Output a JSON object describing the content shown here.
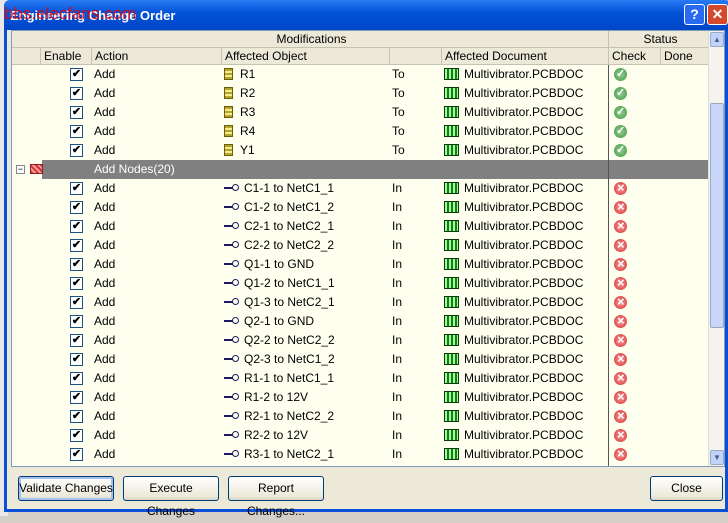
{
  "window": {
    "title": "Engineering Change Order",
    "watermark": "bbs.elecfans.com",
    "help": "?",
    "close": "✕"
  },
  "headers": {
    "group_modifications": "Modifications",
    "group_status": "Status",
    "enable": "Enable",
    "action": "Action",
    "affected_object": "Affected Object",
    "affected_document": "Affected Document",
    "check": "Check",
    "done": "Done"
  },
  "rows": [
    {
      "type": "item",
      "enabled": true,
      "action": "Add",
      "icon": "component-icon",
      "object": "R1",
      "dir": "To",
      "document": "Multivibrator.PCBDOC",
      "check": "ok"
    },
    {
      "type": "item",
      "enabled": true,
      "action": "Add",
      "icon": "component-icon",
      "object": "R2",
      "dir": "To",
      "document": "Multivibrator.PCBDOC",
      "check": "ok"
    },
    {
      "type": "item",
      "enabled": true,
      "action": "Add",
      "icon": "component-icon",
      "object": "R3",
      "dir": "To",
      "document": "Multivibrator.PCBDOC",
      "check": "ok"
    },
    {
      "type": "item",
      "enabled": true,
      "action": "Add",
      "icon": "component-icon",
      "object": "R4",
      "dir": "To",
      "document": "Multivibrator.PCBDOC",
      "check": "ok"
    },
    {
      "type": "item",
      "enabled": true,
      "action": "Add",
      "icon": "component-icon",
      "object": "Y1",
      "dir": "To",
      "document": "Multivibrator.PCBDOC",
      "check": "ok"
    },
    {
      "type": "group",
      "label": "Add Nodes(20)",
      "expanded": true
    },
    {
      "type": "item",
      "enabled": true,
      "action": "Add",
      "icon": "pin-icon",
      "object": "C1-1 to NetC1_1",
      "dir": "In",
      "document": "Multivibrator.PCBDOC",
      "check": "error"
    },
    {
      "type": "item",
      "enabled": true,
      "action": "Add",
      "icon": "pin-icon",
      "object": "C1-2 to NetC1_2",
      "dir": "In",
      "document": "Multivibrator.PCBDOC",
      "check": "error"
    },
    {
      "type": "item",
      "enabled": true,
      "action": "Add",
      "icon": "pin-icon",
      "object": "C2-1 to NetC2_1",
      "dir": "In",
      "document": "Multivibrator.PCBDOC",
      "check": "error"
    },
    {
      "type": "item",
      "enabled": true,
      "action": "Add",
      "icon": "pin-icon",
      "object": "C2-2 to NetC2_2",
      "dir": "In",
      "document": "Multivibrator.PCBDOC",
      "check": "error"
    },
    {
      "type": "item",
      "enabled": true,
      "action": "Add",
      "icon": "pin-icon",
      "object": "Q1-1 to GND",
      "dir": "In",
      "document": "Multivibrator.PCBDOC",
      "check": "error"
    },
    {
      "type": "item",
      "enabled": true,
      "action": "Add",
      "icon": "pin-icon",
      "object": "Q1-2 to NetC1_1",
      "dir": "In",
      "document": "Multivibrator.PCBDOC",
      "check": "error"
    },
    {
      "type": "item",
      "enabled": true,
      "action": "Add",
      "icon": "pin-icon",
      "object": "Q1-3 to NetC2_1",
      "dir": "In",
      "document": "Multivibrator.PCBDOC",
      "check": "error"
    },
    {
      "type": "item",
      "enabled": true,
      "action": "Add",
      "icon": "pin-icon",
      "object": "Q2-1 to GND",
      "dir": "In",
      "document": "Multivibrator.PCBDOC",
      "check": "error"
    },
    {
      "type": "item",
      "enabled": true,
      "action": "Add",
      "icon": "pin-icon",
      "object": "Q2-2 to NetC2_2",
      "dir": "In",
      "document": "Multivibrator.PCBDOC",
      "check": "error"
    },
    {
      "type": "item",
      "enabled": true,
      "action": "Add",
      "icon": "pin-icon",
      "object": "Q2-3 to NetC1_2",
      "dir": "In",
      "document": "Multivibrator.PCBDOC",
      "check": "error"
    },
    {
      "type": "item",
      "enabled": true,
      "action": "Add",
      "icon": "pin-icon",
      "object": "R1-1 to NetC1_1",
      "dir": "In",
      "document": "Multivibrator.PCBDOC",
      "check": "error"
    },
    {
      "type": "item",
      "enabled": true,
      "action": "Add",
      "icon": "pin-icon",
      "object": "R1-2 to 12V",
      "dir": "In",
      "document": "Multivibrator.PCBDOC",
      "check": "error"
    },
    {
      "type": "item",
      "enabled": true,
      "action": "Add",
      "icon": "pin-icon",
      "object": "R2-1 to NetC2_2",
      "dir": "In",
      "document": "Multivibrator.PCBDOC",
      "check": "error"
    },
    {
      "type": "item",
      "enabled": true,
      "action": "Add",
      "icon": "pin-icon",
      "object": "R2-2 to 12V",
      "dir": "In",
      "document": "Multivibrator.PCBDOC",
      "check": "error"
    },
    {
      "type": "item",
      "enabled": true,
      "action": "Add",
      "icon": "pin-icon",
      "object": "R3-1 to NetC2_1",
      "dir": "In",
      "document": "Multivibrator.PCBDOC",
      "check": "error"
    }
  ],
  "buttons": {
    "validate": "Validate Changes",
    "execute": "Execute Changes",
    "report": "Report Changes...",
    "close": "Close"
  }
}
